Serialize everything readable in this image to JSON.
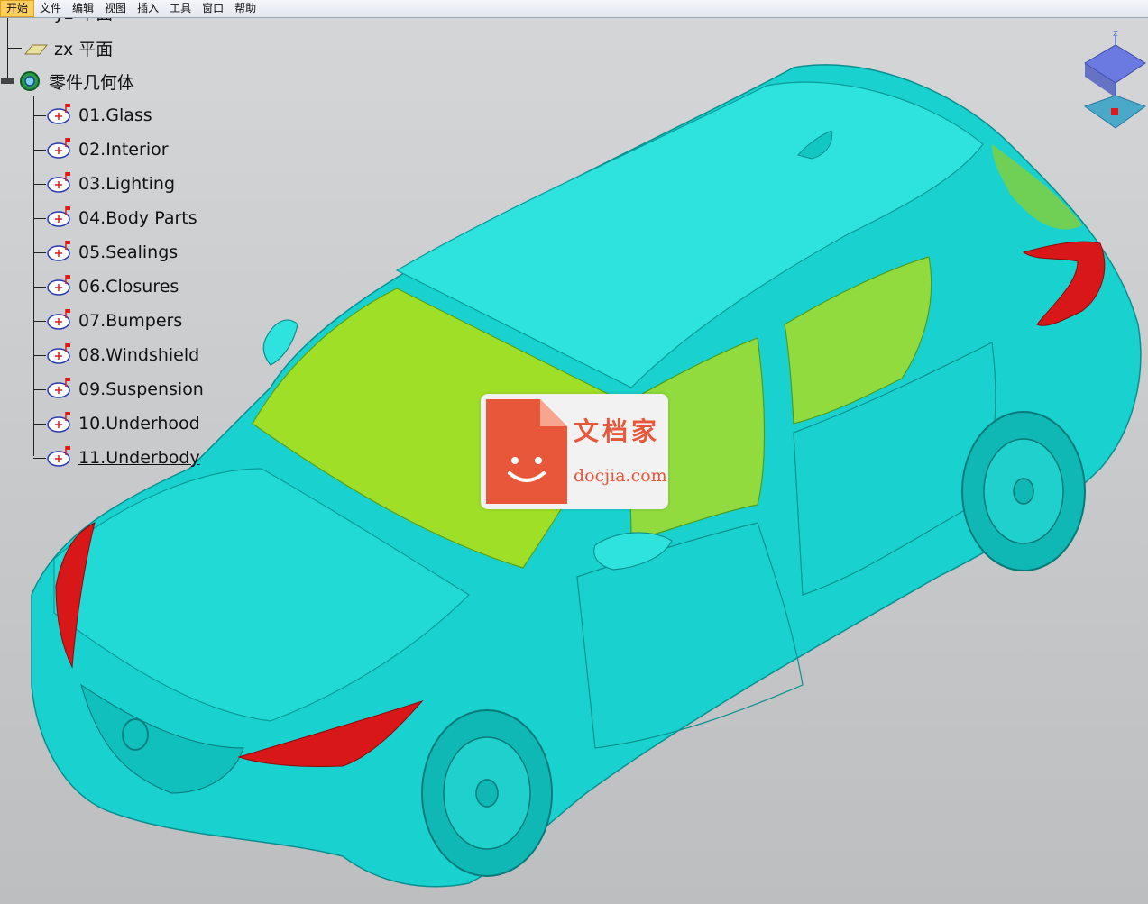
{
  "menubar": {
    "items": [
      "开始",
      "文件",
      "编辑",
      "视图",
      "插入",
      "工具",
      "窗口",
      "帮助"
    ],
    "active_index": 0
  },
  "tree": {
    "yz_plane_label": "yz 平面",
    "zx_plane_label": "zx 平面",
    "part_body_label": "零件几何体",
    "items": [
      {
        "label": "01.Glass"
      },
      {
        "label": "02.Interior"
      },
      {
        "label": "03.Lighting"
      },
      {
        "label": "04.Body Parts"
      },
      {
        "label": "05.Sealings"
      },
      {
        "label": "06.Closures"
      },
      {
        "label": "07.Bumpers"
      },
      {
        "label": "08.Windshield"
      },
      {
        "label": "09.Suspension"
      },
      {
        "label": "10.Underhood"
      },
      {
        "label": "11.Underbody"
      }
    ],
    "selected_index": 10
  },
  "compass": {
    "axis_label": "z"
  },
  "watermark": {
    "title": "文档家",
    "domain": "docjia.com"
  },
  "colors": {
    "background": "#c9cbcd",
    "body": "#00c8c8",
    "body_light": "#33e6e0",
    "glass": "#a8e020",
    "lights": "#d81818",
    "menu_active": "#ffcf5c",
    "watermark": "#e9573a"
  }
}
